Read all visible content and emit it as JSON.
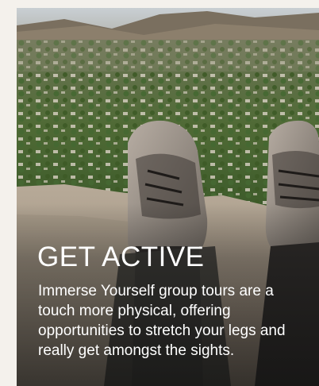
{
  "card": {
    "title": "GET ACTIVE",
    "description": "Immerse Yourself group tours are a touch more physical, offering opportunities to stretch your legs and really get amongst the sights.",
    "image_subject": "hiking-boots-overlooking-town-photo"
  },
  "colors": {
    "page_background": "#f4f1ec",
    "text": "#ffffff"
  }
}
